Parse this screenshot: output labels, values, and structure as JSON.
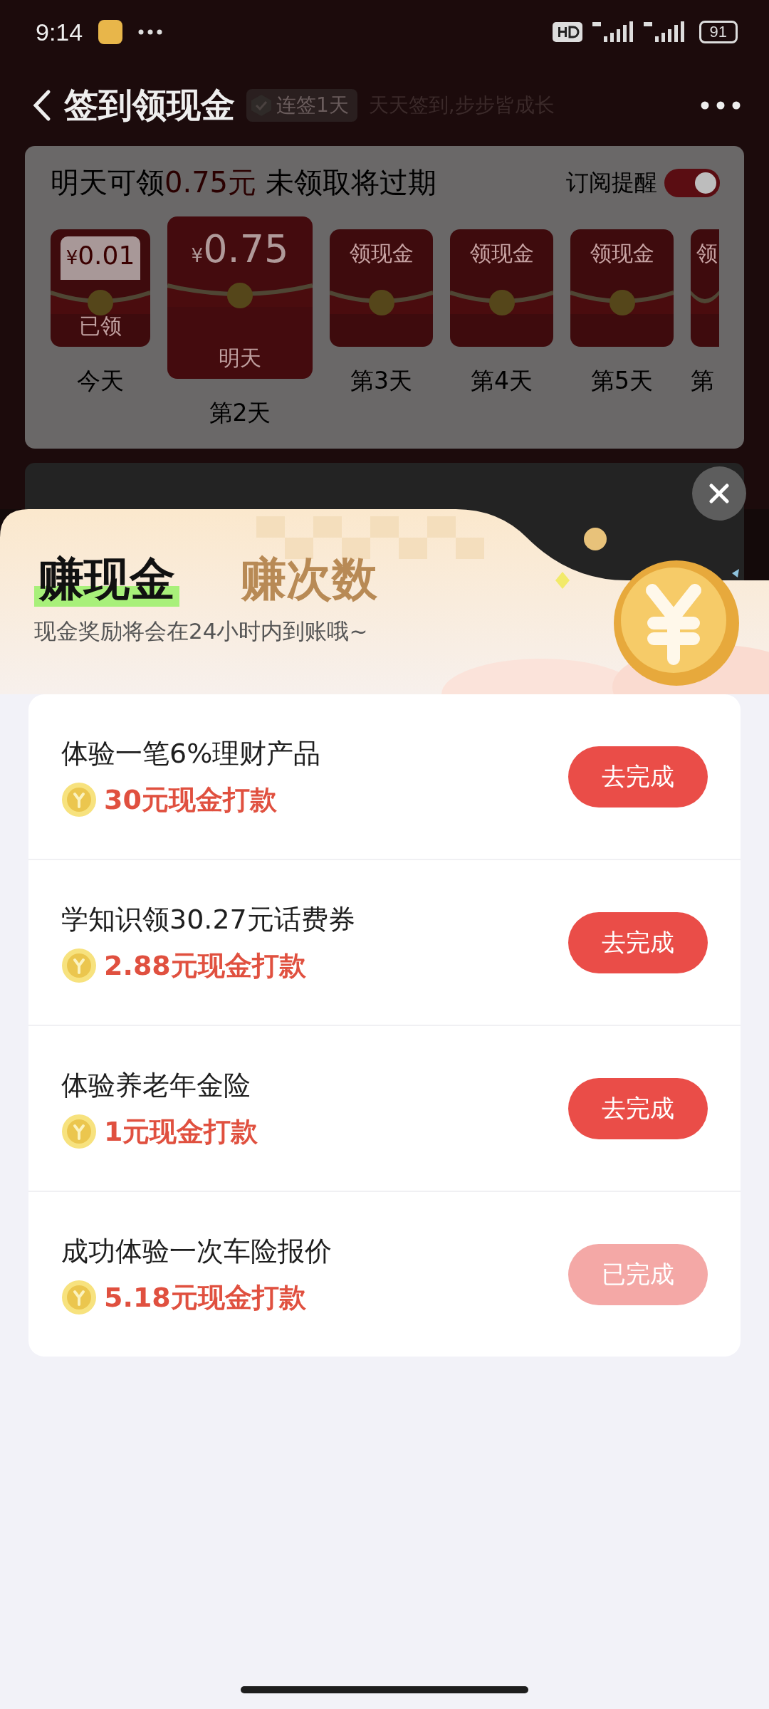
{
  "status_bar": {
    "time": "9:14",
    "battery": "91"
  },
  "nav": {
    "title": "签到领现金",
    "streak_badge": "连签1天",
    "slogan": "天天签到,步步皆成长"
  },
  "signin_card": {
    "headline_prefix": "明天可领",
    "headline_amount": "0.75元",
    "headline_suffix": " 未领取将过期",
    "subscribe": {
      "label": "订阅提醒",
      "on": true
    },
    "days": [
      {
        "kind": "claimed",
        "amount": "0.01",
        "currency": "¥",
        "label": "已领",
        "caption": "今天"
      },
      {
        "kind": "tomorrow",
        "amount": "0.75",
        "currency": "¥",
        "label": "明天",
        "caption": "第2天"
      },
      {
        "kind": "future",
        "label": "领现金",
        "caption": "第3天"
      },
      {
        "kind": "future",
        "label": "领现金",
        "caption": "第4天"
      },
      {
        "kind": "future",
        "label": "领现金",
        "caption": "第5天"
      },
      {
        "kind": "cut",
        "label": "领",
        "caption": "第"
      }
    ]
  },
  "sheet": {
    "tabs": [
      {
        "label": "赚现金",
        "selected": true
      },
      {
        "label": "赚次数",
        "selected": false
      }
    ],
    "subtitle": "现金奖励将会在24小时内到账哦~",
    "tasks": [
      {
        "title": "体验一笔6%理财产品",
        "reward_amount": "30",
        "reward_text": "元现金打款",
        "button": "去完成",
        "done": false
      },
      {
        "title": "学知识领30.27元话费券",
        "reward_amount": "2.88",
        "reward_text": "元现金打款",
        "button": "去完成",
        "done": false
      },
      {
        "title": "体验养老年金险",
        "reward_amount": "1",
        "reward_text": "元现金打款",
        "button": "去完成",
        "done": false
      },
      {
        "title": "成功体验一次车险报价",
        "reward_amount": "5.18",
        "reward_text": "元现金打款",
        "button": "已完成",
        "done": true
      }
    ]
  }
}
